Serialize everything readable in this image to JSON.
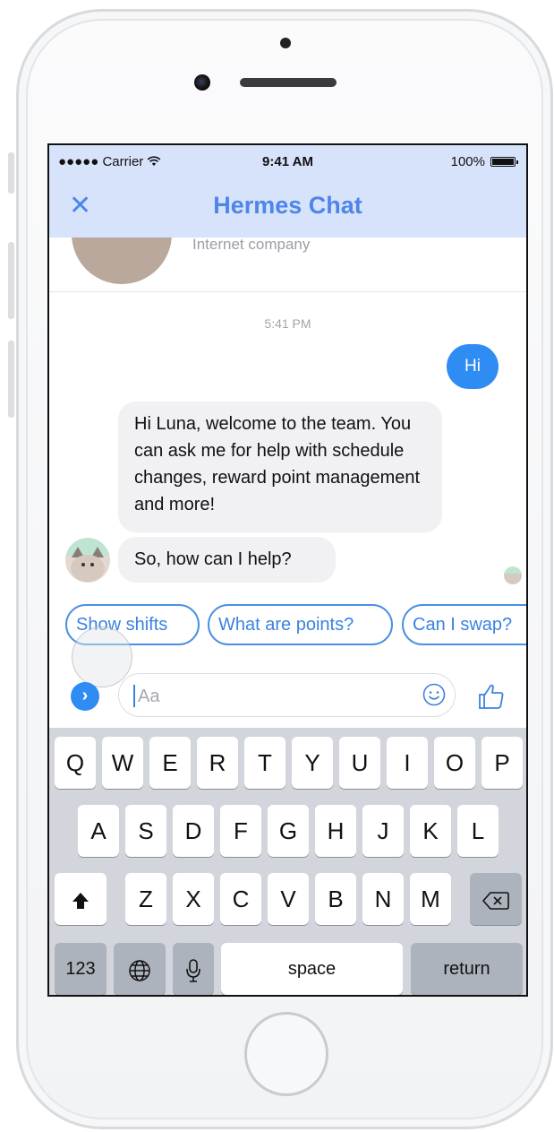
{
  "status_bar": {
    "carrier": "●●●●● Carrier",
    "time": "9:41 AM",
    "battery": "100%"
  },
  "nav": {
    "close_glyph": "✕",
    "title": "Hermes Chat"
  },
  "profile": {
    "subtitle": "Internet company"
  },
  "conversation": {
    "timestamp": "5:41 PM",
    "outgoing": "Hi",
    "incoming": [
      "Hi Luna, welcome to the team. You can ask me for help with schedule changes, reward point management and more!",
      "So, how can I help?"
    ]
  },
  "quick_replies": [
    "Show shifts",
    "What are points?",
    "Can I swap?"
  ],
  "composer": {
    "toggle_glyph": "›",
    "placeholder": "Aa"
  },
  "keyboard": {
    "row1": [
      "Q",
      "W",
      "E",
      "R",
      "T",
      "Y",
      "U",
      "I",
      "O",
      "P"
    ],
    "row2": [
      "A",
      "S",
      "D",
      "F",
      "G",
      "H",
      "J",
      "K",
      "L"
    ],
    "row3": [
      "Z",
      "X",
      "C",
      "V",
      "B",
      "N",
      "M"
    ],
    "numbers": "123",
    "space": "space",
    "return": "return"
  },
  "colors": {
    "header_bg": "#d7e3fb",
    "accent_blue": "#2f8cf3",
    "title_blue": "#4e86e8"
  }
}
